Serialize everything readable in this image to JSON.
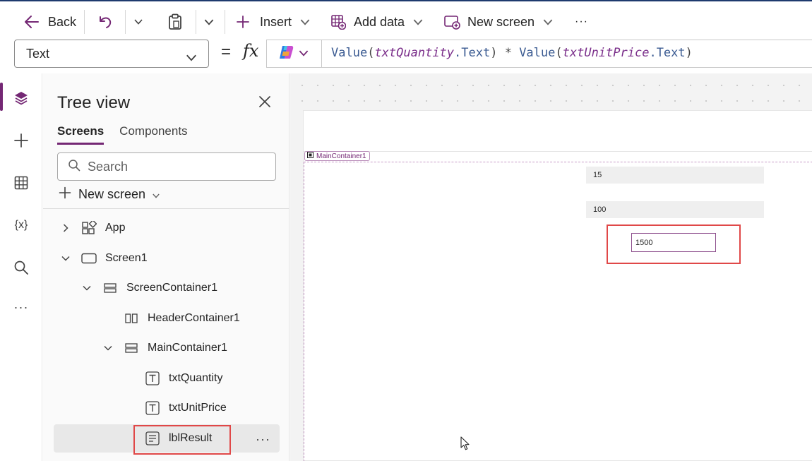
{
  "command_bar": {
    "back_label": "Back",
    "insert_label": "Insert",
    "add_data_label": "Add data",
    "new_screen_label": "New screen",
    "more_label": "···"
  },
  "formula_bar": {
    "property": "Text",
    "equals": "=",
    "fx": "fx",
    "formula": {
      "fn1": "Value",
      "open1": "(",
      "var1": "txtQuantity",
      "prop1": ".Text",
      "close1": ")",
      "op": " * ",
      "fn2": "Value",
      "open2": "(",
      "var2": "txtUnitPrice",
      "prop2": ".Text",
      "close2": ")"
    }
  },
  "rail": {
    "icons": [
      "layers-icon",
      "plus-icon",
      "table-icon",
      "variables-icon",
      "search-icon",
      "more-icon"
    ],
    "variables_label": "{x}",
    "more_label": "···"
  },
  "tree_view": {
    "title": "Tree view",
    "tabs": [
      {
        "label": "Screens",
        "active": true
      },
      {
        "label": "Components",
        "active": false
      }
    ],
    "search_placeholder": "Search",
    "new_screen_label": "New screen",
    "nodes": [
      {
        "label": "App",
        "expand": "collapsed",
        "icon": "app-icon"
      },
      {
        "label": "Screen1",
        "expand": "expanded",
        "icon": "screen-icon"
      },
      {
        "label": "ScreenContainer1",
        "expand": "expanded",
        "icon": "vertical-container-icon"
      },
      {
        "label": "HeaderContainer1",
        "expand": "none",
        "icon": "horizontal-container-icon"
      },
      {
        "label": "MainContainer1",
        "expand": "expanded",
        "icon": "vertical-container-icon"
      },
      {
        "label": "txtQuantity",
        "expand": "none",
        "icon": "text-input-icon"
      },
      {
        "label": "txtUnitPrice",
        "expand": "none",
        "icon": "text-input-icon"
      },
      {
        "label": "lblResult",
        "expand": "none",
        "icon": "label-icon",
        "selected": true
      }
    ],
    "more_label": "···"
  },
  "canvas": {
    "main_container_label": "MainContainer1",
    "quantity_value": "15",
    "unit_price_value": "100",
    "result_value": "1500"
  },
  "colors": {
    "accent": "#742774",
    "highlight": "#e04848",
    "selected_row": "#e8e8e8"
  }
}
